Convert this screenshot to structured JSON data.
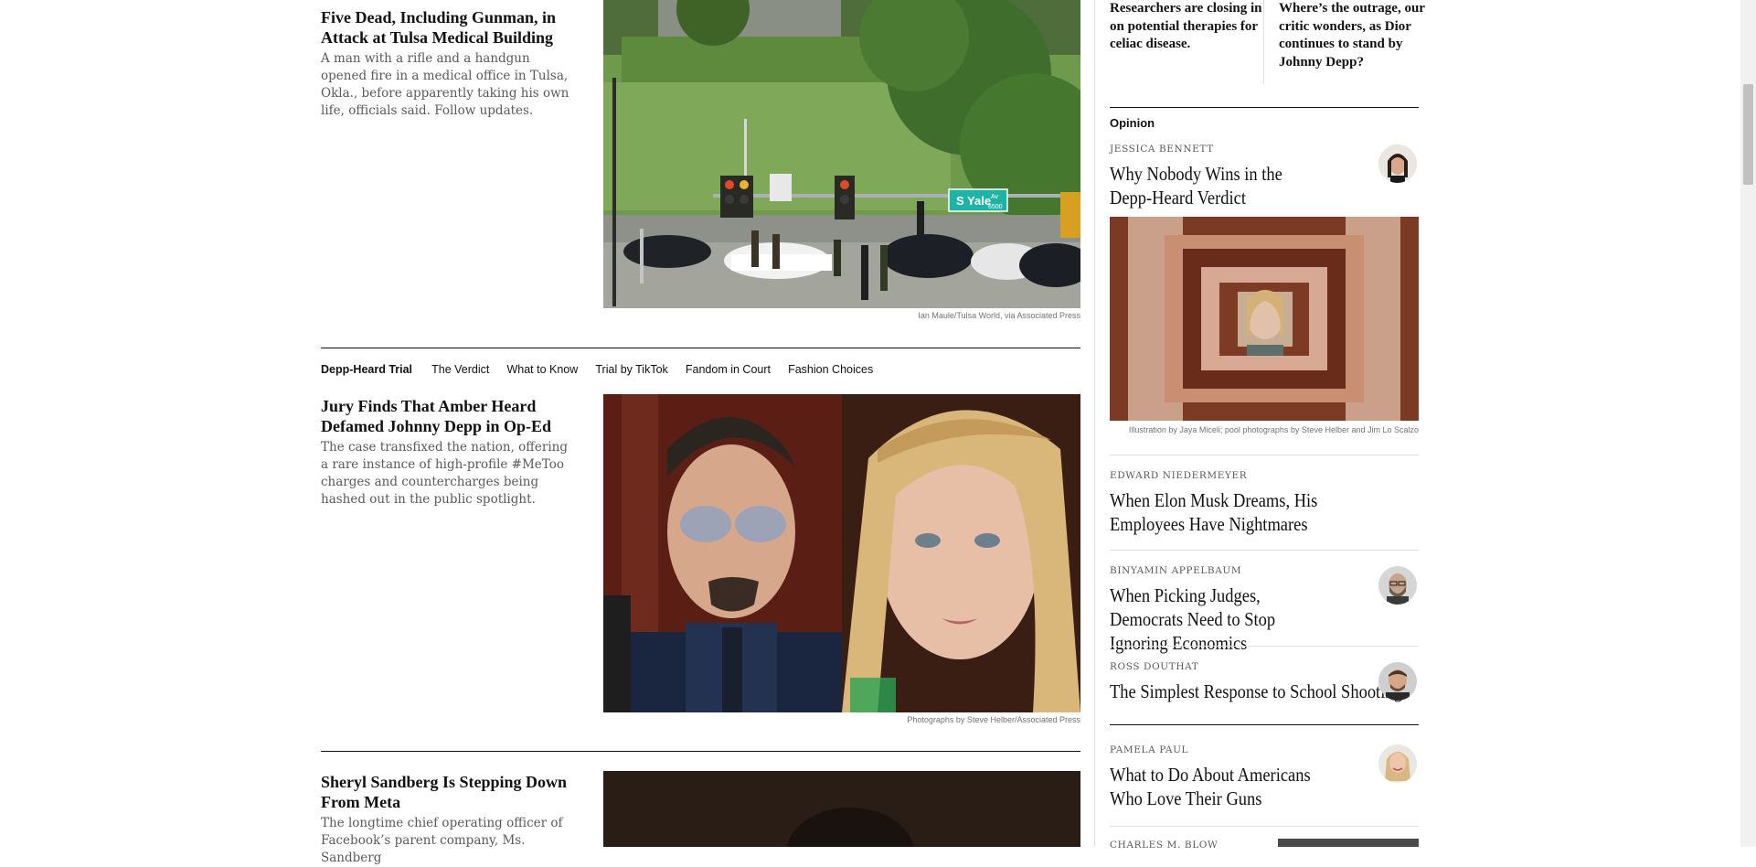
{
  "story1": {
    "headline": "Five Dead, Including Gunman, in Attack at Tulsa Medical Building",
    "summary": "A man with a rifle and a handgun opened fire in a medical office in Tulsa, Okla., before apparently taking his own life, officials said. Follow updates.",
    "image_credit": "Ian Maule/Tulsa World, via Associated Press",
    "street_sign": "S Yale",
    "street_sign_suffix": "Av",
    "street_sign_number": "6500"
  },
  "ribbon": {
    "title": "Depp-Heard Trial",
    "links": [
      "The Verdict",
      "What to Know",
      "Trial by TikTok",
      "Fandom in Court",
      "Fashion Choices"
    ]
  },
  "story2": {
    "headline": "Jury Finds That Amber Heard Defamed Johnny Depp in Op-Ed",
    "summary": "The case transfixed the nation, offering a rare instance of high-profile #MeToo charges and countercharges being hashed out in the public spotlight.",
    "image_credit": "Photographs by Steve Helber/Associated Press"
  },
  "story3": {
    "headline": "Sheryl Sandberg Is Stepping Down From Meta",
    "summary": "The longtime chief operating officer of Facebook’s parent company, Ms. Sandberg"
  },
  "right_top": {
    "left_text": "Researchers are closing in on potential therapies for celiac disease.",
    "right_text": "Where’s the outrage, our critic wonders, as Dior continues to stand by Johnny Depp?"
  },
  "opinion": {
    "label": "Opinion",
    "items": [
      {
        "author": "JESSICA BENNETT",
        "headline": "Why Nobody Wins in the Depp-Heard Verdict"
      },
      {
        "author": "EDWARD NIEDERMEYER",
        "headline": "When Elon Musk Dreams, His Employees Have Nightmares"
      },
      {
        "author": "BINYAMIN APPELBAUM",
        "headline": "When Picking Judges, Democrats Need to Stop Ignoring Economics"
      },
      {
        "author": "ROSS DOUTHAT",
        "headline": "The Simplest Response to School Shootings"
      },
      {
        "author": "PAMELA PAUL",
        "headline": "What to Do About Americans Who Love Their Guns"
      },
      {
        "author": "CHARLES M. BLOW",
        "headline": ""
      }
    ],
    "feature_image_credit": "Illustration by Jaya Miceli; pool photographs by Steve Helber and Jim Lo Scalzo"
  },
  "colors": {
    "text": "#121212",
    "summary": "#5a5a5a",
    "rule": "#dfdfdf",
    "sign_green": "#1fb3a5"
  }
}
